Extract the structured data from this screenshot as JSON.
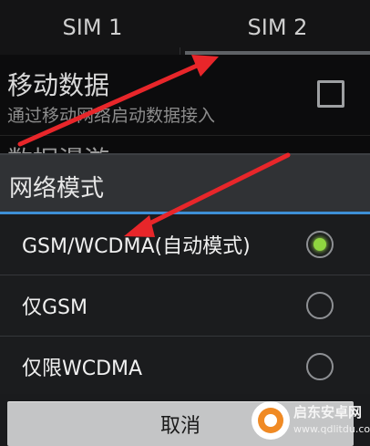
{
  "tabs": [
    {
      "label": "SIM 1",
      "active": false
    },
    {
      "label": "SIM 2",
      "active": true
    }
  ],
  "mobile_data": {
    "title": "移动数据",
    "subtitle": "通过移动网络启动数据接入",
    "checked": false
  },
  "partial_row_label": "数据漫游",
  "dialog": {
    "title": "网络模式",
    "options": [
      {
        "label": "GSM/WCDMA(自动模式)",
        "selected": true
      },
      {
        "label": "仅GSM",
        "selected": false
      },
      {
        "label": "仅限WCDMA",
        "selected": false
      }
    ],
    "cancel_label": "取消"
  },
  "watermark": {
    "title": "启东安卓网",
    "url": "www.qdlitdu.com"
  },
  "colors": {
    "accent_blue": "#3e8fd6",
    "radio_selected": "#8fd640",
    "annotation_arrow": "#e8262a"
  }
}
